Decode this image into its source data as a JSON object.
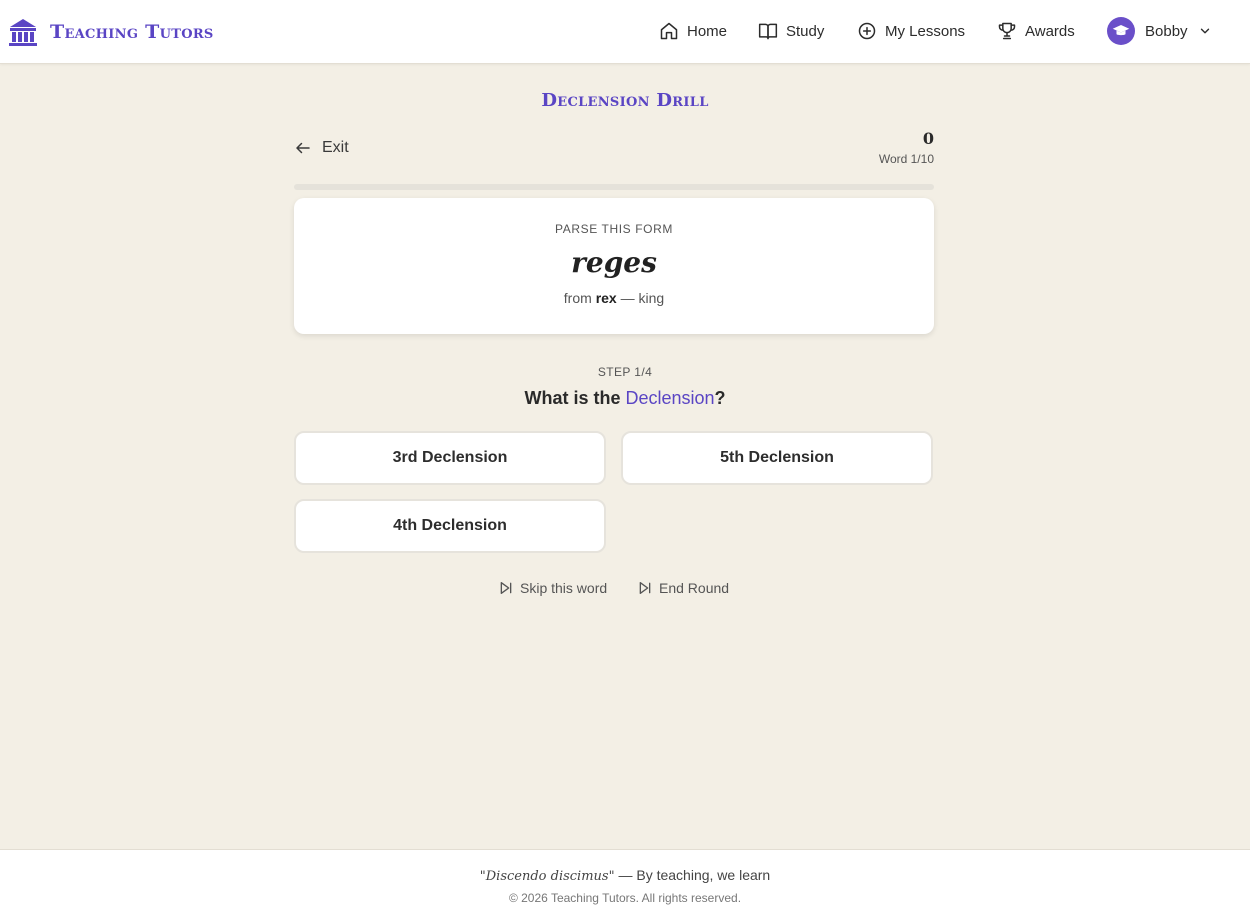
{
  "header": {
    "brand": "Teaching Tutors",
    "nav": [
      {
        "label": "Home",
        "icon": "home-icon"
      },
      {
        "label": "Study",
        "icon": "book-icon"
      },
      {
        "label": "My Lessons",
        "icon": "plus-circle-icon"
      },
      {
        "label": "Awards",
        "icon": "trophy-icon"
      }
    ],
    "user": {
      "name": "Bobby",
      "icon": "graduation-cap-icon"
    }
  },
  "drill": {
    "title": "Declension Drill",
    "exit_label": "Exit",
    "score": "0",
    "word_progress": "Word 1/10",
    "progress_fraction": 0,
    "card": {
      "label": "PARSE THIS FORM",
      "word": "reges",
      "from_prefix": "from",
      "lemma": "rex",
      "separator": "—",
      "meaning": "king"
    },
    "step": "STEP 1/4",
    "question_prefix": "What is the",
    "question_highlight": "Declension",
    "question_suffix": "?",
    "options": [
      "3rd Declension",
      "5th Declension",
      "4th Declension"
    ],
    "skip_label": "Skip this word",
    "end_label": "End Round"
  },
  "footer": {
    "motto_latin": "\"Discendo discimus\"",
    "motto_rest": "— By teaching, we learn",
    "copyright": "© 2026 Teaching Tutors. All rights reserved."
  },
  "colors": {
    "accent": "#5a45c4",
    "background": "#f3efe5",
    "card": "#ffffff"
  }
}
